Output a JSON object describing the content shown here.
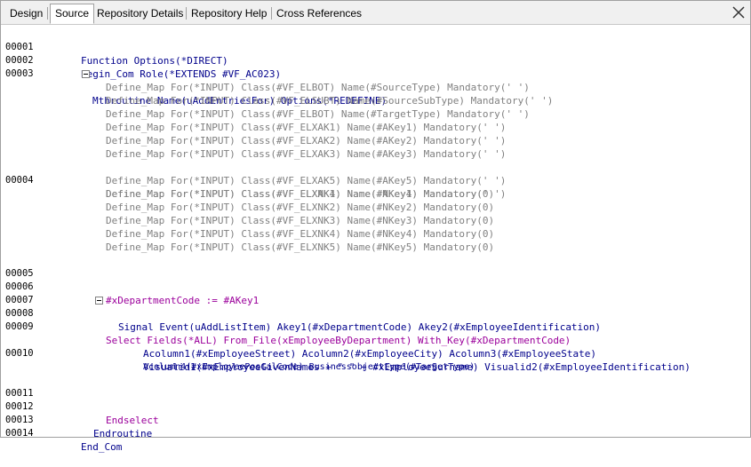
{
  "tabs": [
    {
      "label": "Design"
    },
    {
      "label": "Source"
    },
    {
      "label": "Repository Details"
    },
    {
      "label": "Repository Help"
    },
    {
      "label": "Cross References"
    }
  ],
  "active_tab": "Source",
  "code_lines": [
    {
      "no": "00001",
      "text": "Function Options(*DIRECT)"
    },
    {
      "no": "00002",
      "text": "Begin_Com Role(*EXTENDS #VF_AC023)"
    },
    {
      "no": "00003",
      "text": ""
    },
    {
      "no": "",
      "text": "Mthroutine Name(uAddEntriesFor) Options(*REDEFINE)"
    },
    {
      "no": "",
      "text": "Define_Map For(*INPUT) Class(#VF_ELBOT) Name(#SourceType) Mandatory(' ')"
    },
    {
      "no": "",
      "text": "Define_Map For(*INPUT) Class(#VF_ELSUBT) Name(#SourceSubType) Mandatory(' ')"
    },
    {
      "no": "",
      "text": "Define_Map For(*INPUT) Class(#VF_ELBOT) Name(#TargetType) Mandatory(' ')"
    },
    {
      "no": "",
      "text": "Define_Map For(*INPUT) Class(#VF_ELXAK1) Name(#AKey1) Mandatory(' ')"
    },
    {
      "no": "",
      "text": "Define_Map For(*INPUT) Class(#VF_ELXAK2) Name(#AKey2) Mandatory(' ')"
    },
    {
      "no": "",
      "text": "Define_Map For(*INPUT) Class(#VF_ELXAK3) Name(#AKey3) Mandatory(' ')"
    },
    {
      "no": "00004",
      "text": "Define_Map For(*INPUT) Class(#VF_ELXAK4) Name(#AKey4) Mandatory(' ')"
    },
    {
      "no": "",
      "text": "Define_Map For(*INPUT) Class(#VF_ELXAK5) Name(#AKey5) Mandatory(' ')"
    },
    {
      "no": "",
      "text": "Define_Map For(*INPUT) Class(#VF_ELXNK1) Name(#NKey1) Mandatory(0)"
    },
    {
      "no": "",
      "text": "Define_Map For(*INPUT) Class(#VF_ELXNK2) Name(#NKey2) Mandatory(0)"
    },
    {
      "no": "",
      "text": "Define_Map For(*INPUT) Class(#VF_ELXNK3) Name(#NKey3) Mandatory(0)"
    },
    {
      "no": "",
      "text": "Define_Map For(*INPUT) Class(#VF_ELXNK4) Name(#NKey4) Mandatory(0)"
    },
    {
      "no": "",
      "text": "Define_Map For(*INPUT) Class(#VF_ELXNK5) Name(#NKey5) Mandatory(0)"
    },
    {
      "no": "00005",
      "text": ""
    },
    {
      "no": "00006",
      "text": "#xDepartmentCode := #AKey1"
    },
    {
      "no": "00007",
      "text": ""
    },
    {
      "no": "00008",
      "text": "Select Fields(*ALL) From_File(xEmployeeByDepartment) With_Key(#xDepartmentCode)"
    },
    {
      "no": "00009",
      "text": ""
    },
    {
      "no": "",
      "text": "Signal Event(uAddListItem) Akey1(#xDepartmentCode) Akey2(#xEmployeeIdentification)"
    },
    {
      "no": "00010",
      "text": "Visualid1(#xEmployeeGivenNames + \" \" + #xEmployeeSurname) Visualid2(#xEmployeeIdentification)"
    },
    {
      "no": "",
      "text": "Acolumn1(#xEmployeeStreet) Acolumn2(#xEmployeeCity) Acolumn3(#xEmployeeState)"
    },
    {
      "no": "",
      "text": "Acolumn4(#xEmployeePostalCode) Businessobjecttype(#TargetType)"
    },
    {
      "no": "00011",
      "text": ""
    },
    {
      "no": "00012",
      "text": "Endselect"
    },
    {
      "no": "00013",
      "text": "Endroutine"
    },
    {
      "no": "00014",
      "text": "End_Com"
    }
  ],
  "colors": {
    "keyword": "#00008b",
    "define_map": "#808080",
    "body": "#9b009b",
    "tabbar": "#f0f0f0"
  },
  "icons": {
    "close": "close-icon",
    "fold": "collapse-minus-icon"
  }
}
